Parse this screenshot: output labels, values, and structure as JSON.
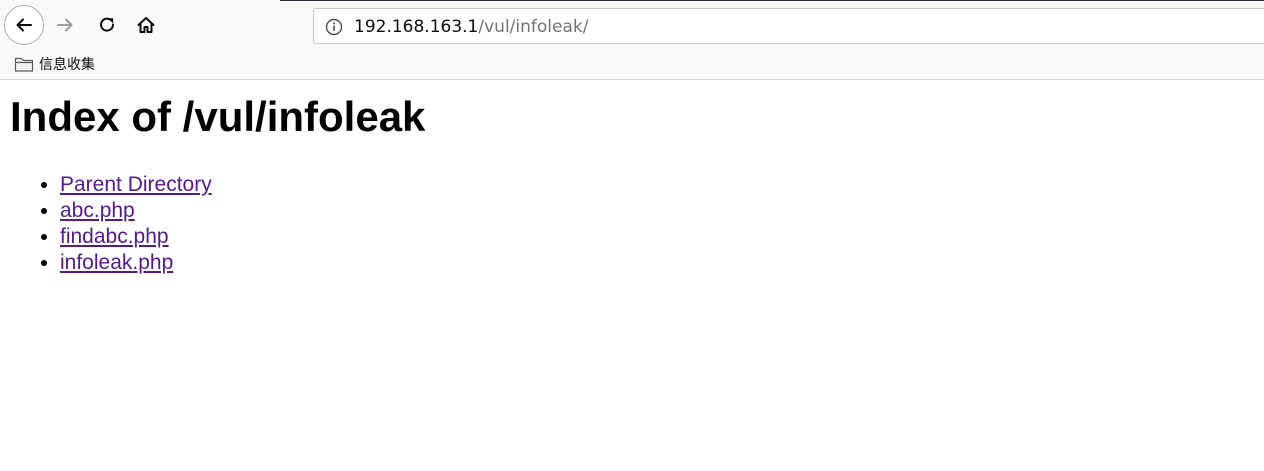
{
  "browser": {
    "url_host": "192.168.163.1",
    "url_path": "/vul/infoleak/",
    "icons": {
      "back": "back-arrow-icon",
      "forward": "forward-arrow-icon",
      "reload": "reload-icon",
      "home": "home-icon",
      "info": "info-icon",
      "folder": "folder-icon"
    }
  },
  "bookmarks": [
    {
      "label": "信息收集",
      "icon": "folder-icon"
    }
  ],
  "page": {
    "heading": "Index of /vul/infoleak",
    "links": [
      {
        "label": "Parent Directory"
      },
      {
        "label": "abc.php"
      },
      {
        "label": "findabc.php"
      },
      {
        "label": "infoleak.php"
      }
    ],
    "link_color": "#551a8b"
  }
}
